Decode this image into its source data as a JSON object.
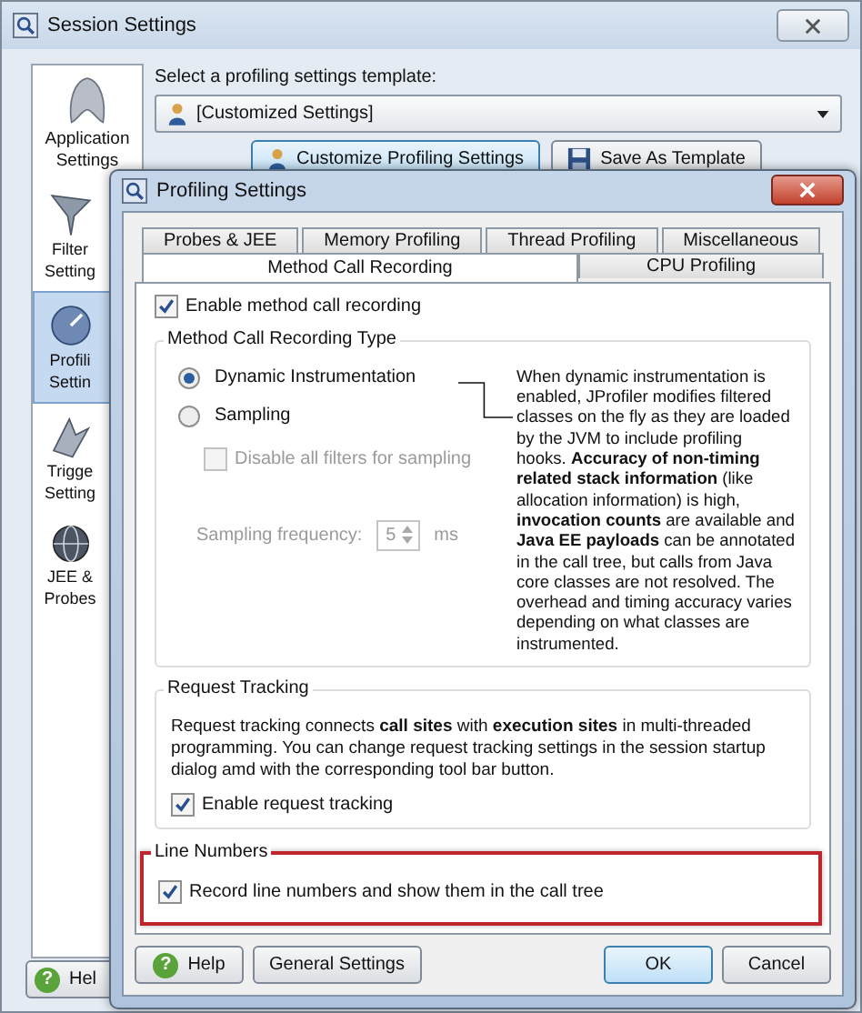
{
  "session_window": {
    "title": "Session Settings",
    "sidebar": [
      {
        "label": "Application Settings",
        "kind": "app",
        "selected": false
      },
      {
        "label": "Filter Setting",
        "kind": "filter",
        "selected": false
      },
      {
        "label": "Profili Settin",
        "kind": "profiling",
        "selected": true
      },
      {
        "label": "Trigge Setting",
        "kind": "trigger",
        "selected": false
      },
      {
        "label": "JEE & Probes",
        "kind": "jee",
        "selected": false
      }
    ],
    "template_label": "Select a profiling settings template:",
    "template_dropdown": {
      "value": "[Customized Settings]"
    },
    "buttons": [
      {
        "label": "Customize Profiling Settings",
        "kind": "person",
        "focused": true
      },
      {
        "label": "Save As Template",
        "kind": "save",
        "focused": false
      }
    ],
    "help_button": {
      "icon": "?",
      "label": "Hel"
    }
  },
  "profiling_dialog": {
    "title": "Profiling Settings",
    "tab_rows": [
      [
        {
          "label": "Probes & JEE",
          "selected": false
        },
        {
          "label": "Memory Profiling",
          "selected": false
        },
        {
          "label": "Thread Profiling",
          "selected": false
        },
        {
          "label": "Miscellaneous",
          "selected": false
        }
      ],
      [
        {
          "label": "Method Call Recording",
          "selected": true
        },
        {
          "label": "CPU Profiling",
          "selected": false
        }
      ]
    ],
    "enable_checkbox": {
      "label": "Enable method call recording",
      "checked": true
    },
    "recording_type": {
      "title": "Method Call Recording Type",
      "radios": [
        {
          "label": "Dynamic Instrumentation",
          "selected": true
        },
        {
          "label": "Sampling",
          "selected": false
        }
      ],
      "disable_filters": {
        "label": "Disable all filters for sampling",
        "checked": false,
        "disabled": true
      },
      "frequency": {
        "label": "Sampling frequency:",
        "value": "5",
        "unit": "ms",
        "disabled": true
      },
      "description": "When dynamic instrumentation is enabled, JProfiler modifies filtered classes on the fly as they are loaded by the JVM to include profiling hooks. **Accuracy of non-timing related stack information** (like allocation information) is high, **invocation counts** are available and **Java EE payloads** can be annotated in the call tree, but calls from Java core classes are not resolved. The overhead and timing accuracy varies depending on what classes are instrumented."
    },
    "request_tracking": {
      "title": "Request Tracking",
      "description": "Request tracking connects **call sites** with **execution sites** in multi-threaded programming. You can change request tracking settings in the session startup dialog amd with the corresponding tool bar button.",
      "checkbox": {
        "label": "Enable request tracking",
        "checked": true
      }
    },
    "line_numbers": {
      "title": "Line Numbers",
      "highlighted": true,
      "checkbox": {
        "label": "Record line numbers and show them in the call tree",
        "checked": true
      }
    },
    "buttons": [
      {
        "label": "Help",
        "icon": "?",
        "default": false
      },
      {
        "label": "General Settings",
        "default": false
      },
      {
        "label": "OK",
        "default": true
      },
      {
        "label": "Cancel",
        "default": false
      }
    ]
  }
}
